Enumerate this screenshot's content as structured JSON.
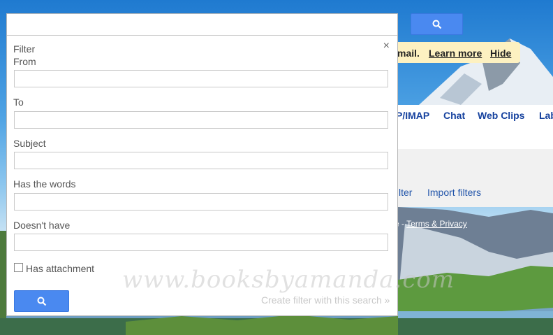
{
  "background": {
    "notice": {
      "text": "mail.",
      "learn_more": "Learn more",
      "hide": "Hide"
    },
    "tabs": [
      "P/IMAP",
      "Chat",
      "Web Clips",
      "Lab"
    ],
    "filter_links": [
      "lter",
      "Import filters"
    ],
    "footer": {
      "prefix": "e - ",
      "terms": "Terms & Privacy"
    },
    "search_icon": "search-icon"
  },
  "dialog": {
    "title": "Filter",
    "close": "×",
    "fields": {
      "from_label": "From",
      "from_value": "",
      "to_label": "To",
      "to_value": "",
      "subject_label": "Subject",
      "subject_value": "",
      "has_words_label": "Has the words",
      "has_words_value": "",
      "doesnt_have_label": "Doesn't have",
      "doesnt_have_value": ""
    },
    "has_attachment_label": "Has attachment",
    "has_attachment_checked": false,
    "create_filter_link": "Create filter with this search »",
    "search_icon": "search-icon"
  },
  "watermark": "www.booksbyamanda.com",
  "colors": {
    "accent_button": "#4a89f0",
    "link_blue": "#15419e",
    "notice_bg": "#fdf1c1"
  }
}
